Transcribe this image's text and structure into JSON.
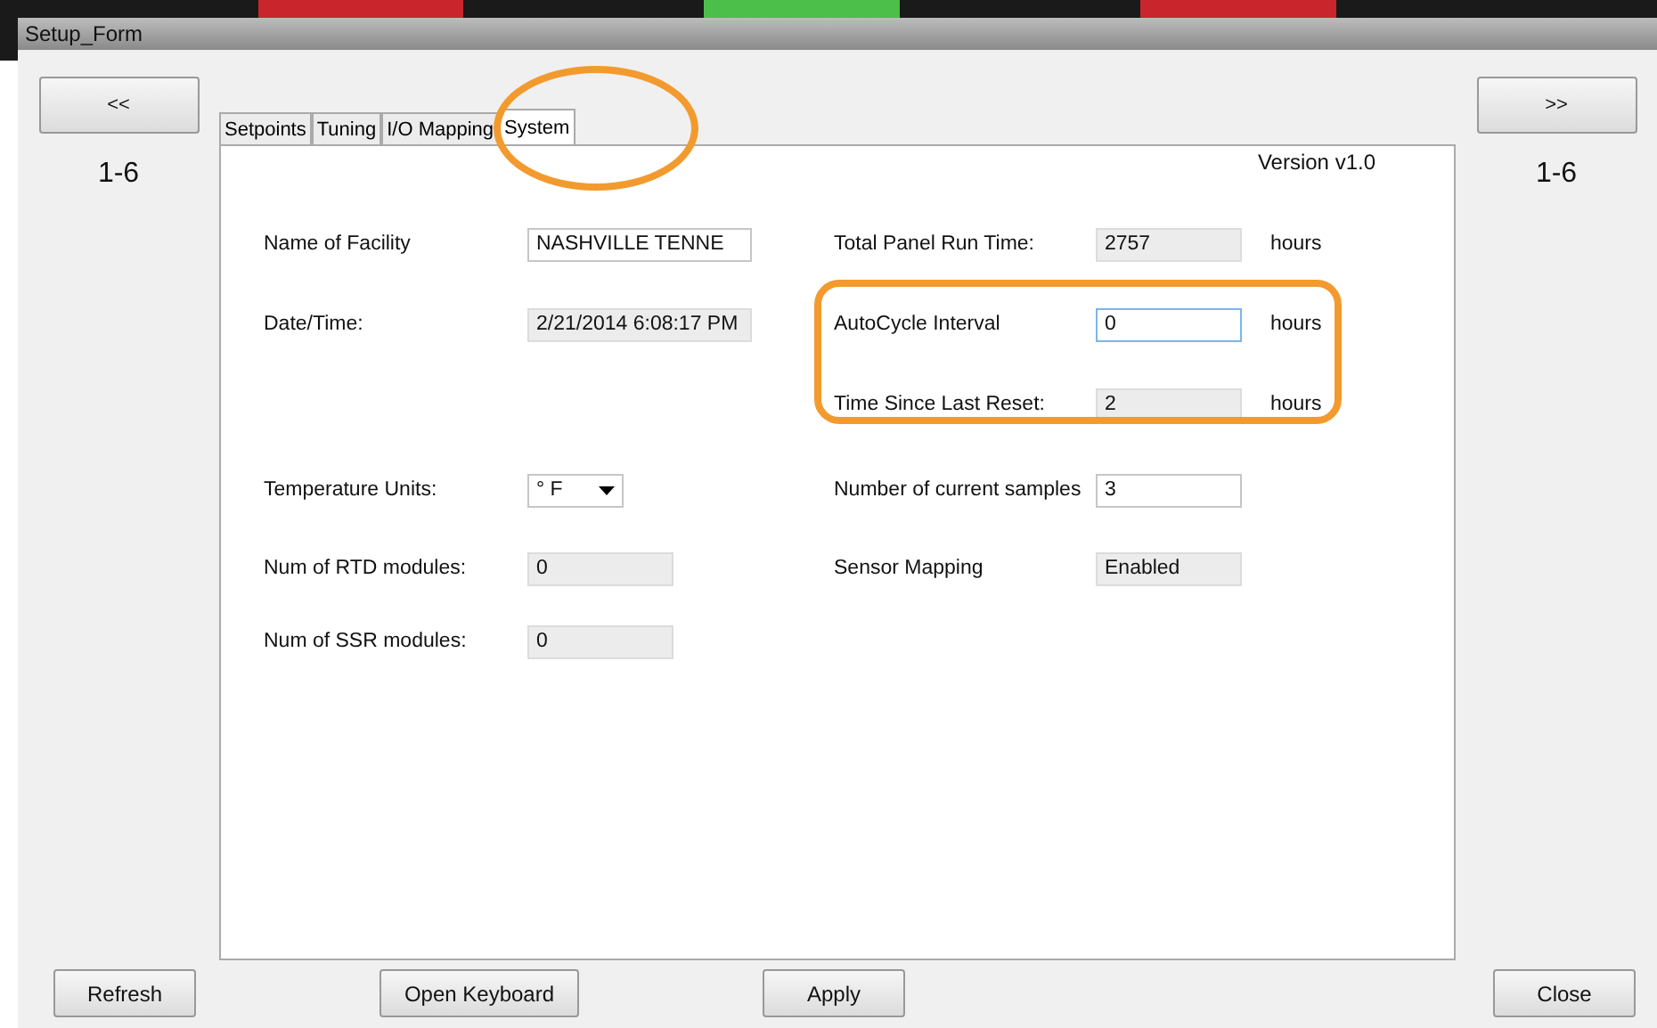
{
  "window": {
    "title": "Setup_Form"
  },
  "nav": {
    "prev": {
      "label": "<<",
      "range": "1-6"
    },
    "next": {
      "label": ">>",
      "range": "1-6"
    }
  },
  "tabs": [
    {
      "label": "Setpoints",
      "selected": false
    },
    {
      "label": "Tuning",
      "selected": false
    },
    {
      "label": "I/O Mapping",
      "selected": false
    },
    {
      "label": "System",
      "selected": true
    }
  ],
  "version": "Version v1.0",
  "left_fields": [
    {
      "label": "Name of Facility",
      "kind": "text",
      "value": "NASHVILLE TENNE"
    },
    {
      "label": "Date/Time:",
      "kind": "readonly",
      "value": "2/21/2014 6:08:17 PM"
    },
    {
      "label": "Temperature Units:",
      "kind": "dropdown",
      "value": "° F"
    },
    {
      "label": "Num of RTD modules:",
      "kind": "readonly",
      "value": "0"
    },
    {
      "label": "Num of SSR modules:",
      "kind": "readonly",
      "value": "0"
    }
  ],
  "right_fields": [
    {
      "label": "Total Panel Run Time:",
      "kind": "readonly",
      "value": "2757",
      "unit": "hours"
    },
    {
      "label": "AutoCycle Interval",
      "kind": "focused",
      "value": "0",
      "unit": "hours"
    },
    {
      "label": "Time Since Last Reset:",
      "kind": "readonly",
      "value": "2",
      "unit": "hours"
    },
    {
      "label": "Number of current samples",
      "kind": "text",
      "value": "3"
    },
    {
      "label": "Sensor Mapping",
      "kind": "readonly",
      "value": "Enabled"
    }
  ],
  "buttons": {
    "refresh": "Refresh",
    "open_keyboard": "Open Keyboard",
    "apply": "Apply",
    "close": "Close"
  }
}
